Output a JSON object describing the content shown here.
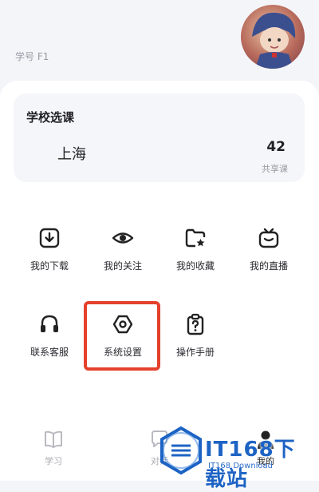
{
  "header": {
    "student_id": "学号 F1"
  },
  "course_card": {
    "title": "学校选课",
    "city": "上海",
    "count": "42",
    "count_label": "共享课"
  },
  "grid": {
    "download": "我的下载",
    "follow": "我的关注",
    "favorite": "我的收藏",
    "live": "我的直播",
    "support": "联系客服",
    "settings": "系统设置",
    "manual": "操作手册"
  },
  "tabbar": {
    "study": "学习",
    "chat": "对话",
    "me": "我的"
  },
  "watermark": {
    "brand": "IT168下载站",
    "sub": "IT168 Download"
  },
  "colors": {
    "highlight": "#e4412c",
    "watermark": "#1d63c4"
  }
}
